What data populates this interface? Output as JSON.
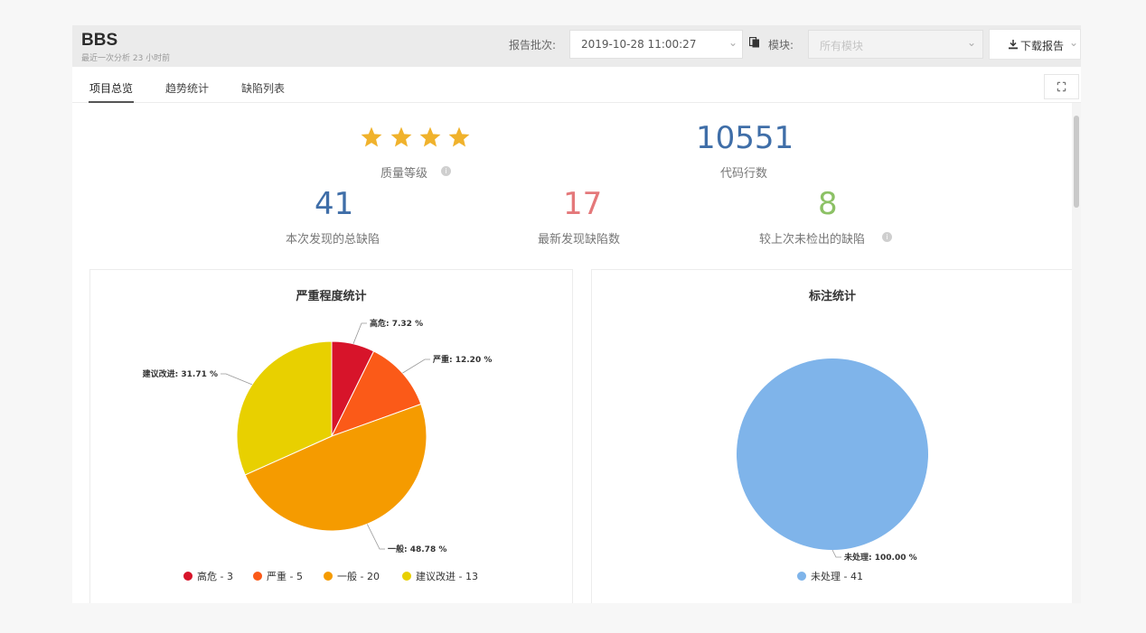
{
  "header": {
    "title": "BBS",
    "subtitle": "最近一次分析 23 小时前",
    "batch_label": "报告批次:",
    "batch_value": "2019-10-28 11:00:27",
    "module_label": "模块:",
    "module_placeholder": "所有模块",
    "download_label": "下载报告"
  },
  "tabs": [
    {
      "label": "项目总览",
      "active": true
    },
    {
      "label": "趋势统计",
      "active": false
    },
    {
      "label": "缺陷列表",
      "active": false
    }
  ],
  "stats": {
    "quality_stars": 4,
    "quality_label": "质量等级",
    "loc_value": "10551",
    "loc_label": "代码行数",
    "total_defects": "41",
    "total_defects_label": "本次发现的总缺陷",
    "new_defects": "17",
    "new_defects_label": "最新发现缺陷数",
    "undetected": "8",
    "undetected_label": "较上次未检出的缺陷"
  },
  "colors": {
    "star": "#f0b22c",
    "loc": "#3f6ea8",
    "total": "#3f6ea8",
    "new": "#e4787a",
    "undetected": "#8cc165"
  },
  "chart_data": [
    {
      "type": "pie",
      "title": "严重程度统计",
      "categories": [
        "高危",
        "严重",
        "一般",
        "建议改进"
      ],
      "values": [
        3,
        5,
        20,
        13
      ],
      "data_labels": [
        "高危: 7.32 %",
        "严重: 12.20 %",
        "一般: 48.78 %",
        "建议改进: 31.71 %"
      ],
      "legend": [
        "高危 - 3",
        "严重 - 5",
        "一般 - 20",
        "建议改进 - 13"
      ],
      "colors": [
        "#d7142a",
        "#fb5a18",
        "#f59b00",
        "#e8d000"
      ],
      "legend_position": "bottom"
    },
    {
      "type": "pie",
      "title": "标注统计",
      "categories": [
        "未处理"
      ],
      "values": [
        41
      ],
      "data_labels": [
        "未处理: 100.00 %"
      ],
      "legend": [
        "未处理 - 41"
      ],
      "colors": [
        "#7fb4ea"
      ],
      "legend_position": "bottom"
    }
  ]
}
